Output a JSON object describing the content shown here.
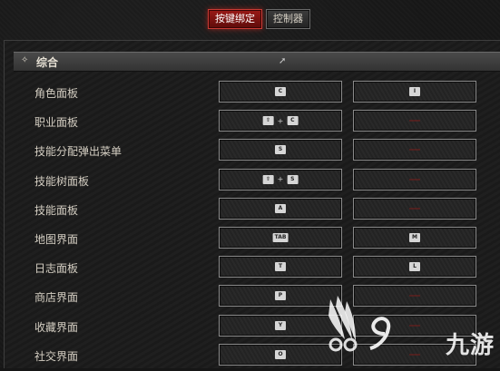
{
  "tabs": [
    {
      "label": "按键绑定",
      "active": true
    },
    {
      "label": "控制器",
      "active": false
    }
  ],
  "section": {
    "title": "综合"
  },
  "rows": [
    {
      "label": "角色面板",
      "primary": [
        "C"
      ],
      "secondary": [
        "I"
      ]
    },
    {
      "label": "职业面板",
      "primary": [
        "⇧",
        "C"
      ],
      "secondary": []
    },
    {
      "label": "技能分配弹出菜单",
      "primary": [
        "S"
      ],
      "secondary": []
    },
    {
      "label": "技能树面板",
      "primary": [
        "⇧",
        "S"
      ],
      "secondary": []
    },
    {
      "label": "技能面板",
      "primary": [
        "A"
      ],
      "secondary": []
    },
    {
      "label": "地图界面",
      "primary": [
        "TAB"
      ],
      "secondary": [
        "M"
      ]
    },
    {
      "label": "日志面板",
      "primary": [
        "T"
      ],
      "secondary": [
        "L"
      ]
    },
    {
      "label": "商店界面",
      "primary": [
        "P"
      ],
      "secondary": []
    },
    {
      "label": "收藏界面",
      "primary": [
        "Y"
      ],
      "secondary": []
    },
    {
      "label": "社交界面",
      "primary": [
        "O"
      ],
      "secondary": []
    }
  ],
  "plus_symbol": "+",
  "watermark": {
    "text": "九游"
  },
  "colors": {
    "active_tab": "#8e1613",
    "unbound_marker": "#7a1d1b"
  }
}
